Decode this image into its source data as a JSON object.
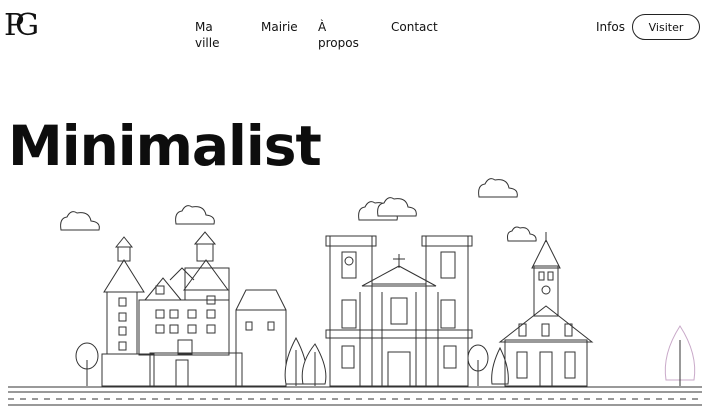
{
  "header": {
    "logo_text": "PG",
    "nav": [
      "Ma ville",
      "Mairie",
      "À propos",
      "Contact"
    ],
    "infos_label": "Infos",
    "visit_label": "Visiter"
  },
  "hero": {
    "title": "Minimalist"
  },
  "illustration": {
    "subject": "line-art city skyline with castle, cathedral and church",
    "stroke_color": "#333333",
    "accent_color": "#c9a9c9"
  }
}
